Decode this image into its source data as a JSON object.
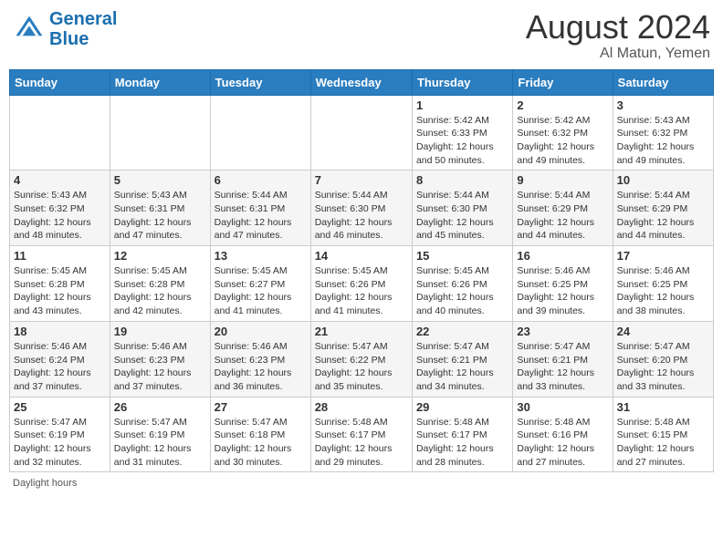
{
  "header": {
    "logo_line1": "General",
    "logo_line2": "Blue",
    "month_year": "August 2024",
    "location": "Al Matun, Yemen"
  },
  "days_of_week": [
    "Sunday",
    "Monday",
    "Tuesday",
    "Wednesday",
    "Thursday",
    "Friday",
    "Saturday"
  ],
  "weeks": [
    [
      {
        "day": "",
        "info": ""
      },
      {
        "day": "",
        "info": ""
      },
      {
        "day": "",
        "info": ""
      },
      {
        "day": "",
        "info": ""
      },
      {
        "day": "1",
        "info": "Sunrise: 5:42 AM\nSunset: 6:33 PM\nDaylight: 12 hours\nand 50 minutes."
      },
      {
        "day": "2",
        "info": "Sunrise: 5:42 AM\nSunset: 6:32 PM\nDaylight: 12 hours\nand 49 minutes."
      },
      {
        "day": "3",
        "info": "Sunrise: 5:43 AM\nSunset: 6:32 PM\nDaylight: 12 hours\nand 49 minutes."
      }
    ],
    [
      {
        "day": "4",
        "info": "Sunrise: 5:43 AM\nSunset: 6:32 PM\nDaylight: 12 hours\nand 48 minutes."
      },
      {
        "day": "5",
        "info": "Sunrise: 5:43 AM\nSunset: 6:31 PM\nDaylight: 12 hours\nand 47 minutes."
      },
      {
        "day": "6",
        "info": "Sunrise: 5:44 AM\nSunset: 6:31 PM\nDaylight: 12 hours\nand 47 minutes."
      },
      {
        "day": "7",
        "info": "Sunrise: 5:44 AM\nSunset: 6:30 PM\nDaylight: 12 hours\nand 46 minutes."
      },
      {
        "day": "8",
        "info": "Sunrise: 5:44 AM\nSunset: 6:30 PM\nDaylight: 12 hours\nand 45 minutes."
      },
      {
        "day": "9",
        "info": "Sunrise: 5:44 AM\nSunset: 6:29 PM\nDaylight: 12 hours\nand 44 minutes."
      },
      {
        "day": "10",
        "info": "Sunrise: 5:44 AM\nSunset: 6:29 PM\nDaylight: 12 hours\nand 44 minutes."
      }
    ],
    [
      {
        "day": "11",
        "info": "Sunrise: 5:45 AM\nSunset: 6:28 PM\nDaylight: 12 hours\nand 43 minutes."
      },
      {
        "day": "12",
        "info": "Sunrise: 5:45 AM\nSunset: 6:28 PM\nDaylight: 12 hours\nand 42 minutes."
      },
      {
        "day": "13",
        "info": "Sunrise: 5:45 AM\nSunset: 6:27 PM\nDaylight: 12 hours\nand 41 minutes."
      },
      {
        "day": "14",
        "info": "Sunrise: 5:45 AM\nSunset: 6:26 PM\nDaylight: 12 hours\nand 41 minutes."
      },
      {
        "day": "15",
        "info": "Sunrise: 5:45 AM\nSunset: 6:26 PM\nDaylight: 12 hours\nand 40 minutes."
      },
      {
        "day": "16",
        "info": "Sunrise: 5:46 AM\nSunset: 6:25 PM\nDaylight: 12 hours\nand 39 minutes."
      },
      {
        "day": "17",
        "info": "Sunrise: 5:46 AM\nSunset: 6:25 PM\nDaylight: 12 hours\nand 38 minutes."
      }
    ],
    [
      {
        "day": "18",
        "info": "Sunrise: 5:46 AM\nSunset: 6:24 PM\nDaylight: 12 hours\nand 37 minutes."
      },
      {
        "day": "19",
        "info": "Sunrise: 5:46 AM\nSunset: 6:23 PM\nDaylight: 12 hours\nand 37 minutes."
      },
      {
        "day": "20",
        "info": "Sunrise: 5:46 AM\nSunset: 6:23 PM\nDaylight: 12 hours\nand 36 minutes."
      },
      {
        "day": "21",
        "info": "Sunrise: 5:47 AM\nSunset: 6:22 PM\nDaylight: 12 hours\nand 35 minutes."
      },
      {
        "day": "22",
        "info": "Sunrise: 5:47 AM\nSunset: 6:21 PM\nDaylight: 12 hours\nand 34 minutes."
      },
      {
        "day": "23",
        "info": "Sunrise: 5:47 AM\nSunset: 6:21 PM\nDaylight: 12 hours\nand 33 minutes."
      },
      {
        "day": "24",
        "info": "Sunrise: 5:47 AM\nSunset: 6:20 PM\nDaylight: 12 hours\nand 33 minutes."
      }
    ],
    [
      {
        "day": "25",
        "info": "Sunrise: 5:47 AM\nSunset: 6:19 PM\nDaylight: 12 hours\nand 32 minutes."
      },
      {
        "day": "26",
        "info": "Sunrise: 5:47 AM\nSunset: 6:19 PM\nDaylight: 12 hours\nand 31 minutes."
      },
      {
        "day": "27",
        "info": "Sunrise: 5:47 AM\nSunset: 6:18 PM\nDaylight: 12 hours\nand 30 minutes."
      },
      {
        "day": "28",
        "info": "Sunrise: 5:48 AM\nSunset: 6:17 PM\nDaylight: 12 hours\nand 29 minutes."
      },
      {
        "day": "29",
        "info": "Sunrise: 5:48 AM\nSunset: 6:17 PM\nDaylight: 12 hours\nand 28 minutes."
      },
      {
        "day": "30",
        "info": "Sunrise: 5:48 AM\nSunset: 6:16 PM\nDaylight: 12 hours\nand 27 minutes."
      },
      {
        "day": "31",
        "info": "Sunrise: 5:48 AM\nSunset: 6:15 PM\nDaylight: 12 hours\nand 27 minutes."
      }
    ]
  ],
  "footer": "Daylight hours"
}
